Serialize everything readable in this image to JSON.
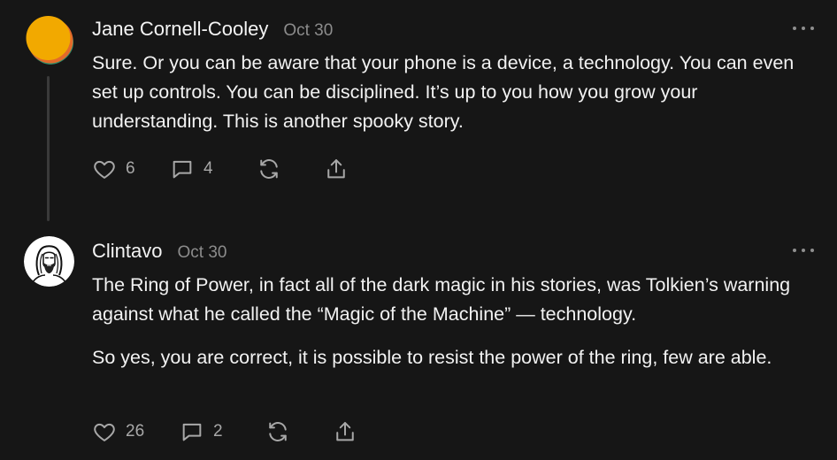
{
  "posts": [
    {
      "author": "Jane Cornell-Cooley",
      "date": "Oct 30",
      "paragraphs": [
        "Sure. Or you can be aware that your phone is a device, a technology. You can even set up controls. You can be disciplined. It’s up to you how you grow your understanding. This is another spooky story."
      ],
      "likes": "6",
      "comments": "4",
      "avatar_colors": [
        "#f2a900",
        "#e36a2b",
        "#2f8f6b"
      ]
    },
    {
      "author": "Clintavo",
      "date": "Oct 30",
      "paragraphs": [
        "The Ring of Power, in fact all of the dark magic in his stories, was Tolkien’s warning against what he called the “Magic of the Machine” — technology.",
        "So yes, you are correct, it is possible to resist the power of the ring, few are able."
      ],
      "likes": "26",
      "comments": "2"
    }
  ],
  "icons": {
    "like": "heart-icon",
    "comment": "speech-bubble-icon",
    "restack": "restack-icon",
    "share": "share-icon",
    "more": "more-options-icon"
  }
}
